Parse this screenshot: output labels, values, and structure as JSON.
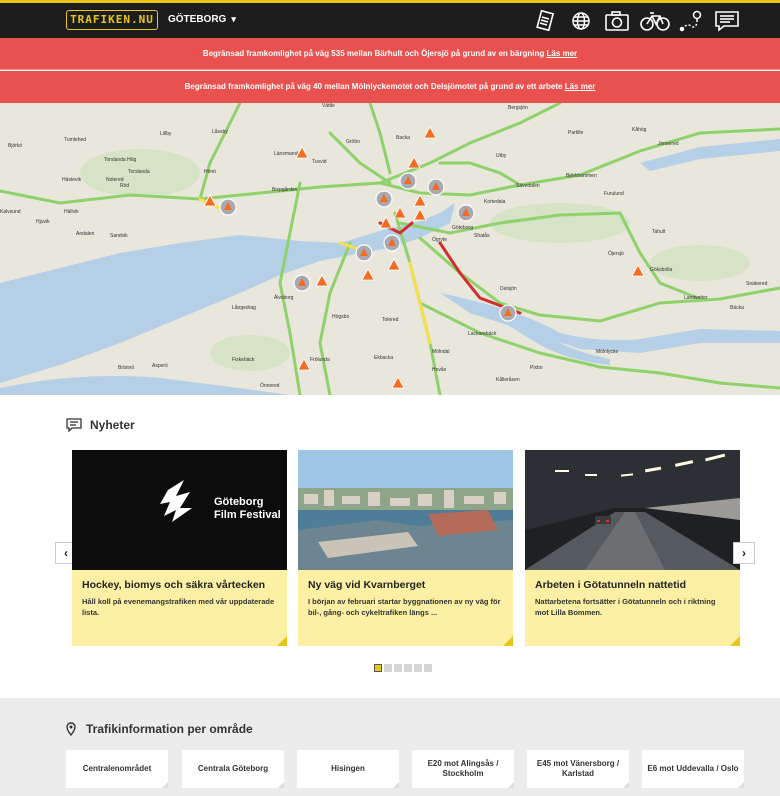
{
  "header": {
    "logo": "TRAFIKEN.NU",
    "city": "GÖTEBORG",
    "icons": [
      "ticket-icon",
      "globe-icon",
      "camera-icon",
      "bicycle-icon",
      "route-icon",
      "message-icon"
    ]
  },
  "alerts": [
    {
      "text": "Begränsad framkomlighet på väg 535 mellan Bärhult och Öjersjö på grund av en bärgning",
      "link": "Läs mer"
    },
    {
      "text": "Begränsad framkomlighet på väg 40 mellan Mölnlyckemotet och Delsjömotet på grund av ett arbete",
      "link": "Läs mer"
    }
  ],
  "map": {
    "labels": [
      "Bergsjön",
      "Vättle",
      "Partille",
      "Kåhög",
      "Jonsered",
      "Tumlehed",
      "Lillby",
      "Låssby",
      "Björkö",
      "Torslanda Hög",
      "Torslanda",
      "Hästevik",
      "Nolered",
      "Röd",
      "Hönö",
      "Hällvik",
      "Andalen",
      "Sandvik",
      "Kalvsund",
      "Hjuvik",
      "Bispgården",
      "Länsmanskol",
      "Tuvvid",
      "Gröbo",
      "Backa",
      "Utby",
      "Sävedalen",
      "Björkhammen",
      "Furulund",
      "Göteborg",
      "Ögryte",
      "Shatås",
      "Delsjön",
      "Tahult",
      "Öjersjö",
      "Göksbolla",
      "Landvetter",
      "Bäcka",
      "Snäkered",
      "Långedrag",
      "Älvsborg",
      "Högsbo",
      "Hovås",
      "Frölunda",
      "Ekbacka",
      "Brännö",
      "Asperö",
      "Fiskebäck",
      "Önnered",
      "Mölndal",
      "Lackarebäck",
      "Mölnlycke",
      "Pixbo",
      "Kålleråsen",
      "Tolered",
      "Kortedala"
    ],
    "colors": {
      "water": "#b4cfe6",
      "land": "#e9e6dc",
      "road": "#8fd16a",
      "slow": "#f4e04a",
      "jam": "#cf2f2f",
      "incident": "#f26d21"
    }
  },
  "news": {
    "heading": "Nyheter",
    "cards": [
      {
        "title": "Hockey, biomys och säkra vårtecken",
        "text": "Håll koll på evenemangstrafiken med vår uppdaterade lista.",
        "image_text_1": "Göteborg",
        "image_text_2": "Film Festival"
      },
      {
        "title": "Ny väg vid Kvarnberget",
        "text": "I början av februari startar byggnationen av ny väg för bil-, gång- och cykeltrafiken längs ..."
      },
      {
        "title": "Arbeten i Götatunneln nattetid",
        "text": "Nattarbetena fortsätter i Götatunneln och i riktning mot Lilla Bommen."
      }
    ],
    "prev": "‹",
    "next": "›",
    "dots": 6,
    "active_dot": 0
  },
  "traffic": {
    "heading": "Trafikinformation per område",
    "areas": [
      "Centralenområdet",
      "Centrala Göteborg",
      "Hisingen",
      "E20 mot Alingsås / Stockholm",
      "E45 mot Vänersborg / Karlstad",
      "E6 mot Uddevalla / Oslo"
    ]
  }
}
